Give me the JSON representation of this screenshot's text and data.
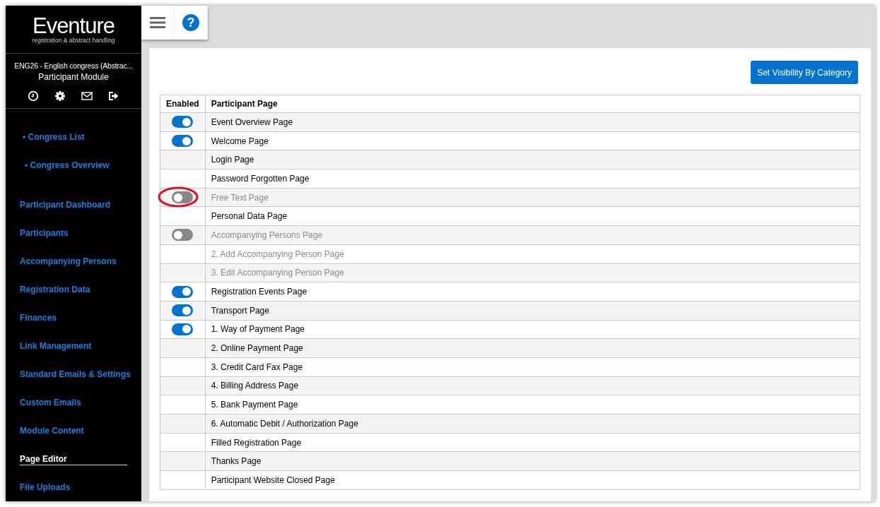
{
  "sidebar": {
    "logo": {
      "title": "Eventure",
      "tagline": "registration & abstract handling"
    },
    "congress": "ENG26 - English congress (Abstrac...",
    "module": "Participant Module",
    "items": [
      {
        "label": "• Congress List",
        "kind": "sub",
        "selected": false
      },
      {
        "label": "• Congress Overview",
        "kind": "sub",
        "selected": false
      },
      {
        "label": "Participant Dashboard",
        "kind": "main",
        "selected": false
      },
      {
        "label": "Participants",
        "kind": "main",
        "selected": false
      },
      {
        "label": "Accompanying Persons",
        "kind": "main",
        "selected": false
      },
      {
        "label": "Registration Data",
        "kind": "main",
        "selected": false
      },
      {
        "label": "Finances",
        "kind": "main",
        "selected": false
      },
      {
        "label": "Link Management",
        "kind": "main",
        "selected": false
      },
      {
        "label": "Standard Emails & Settings",
        "kind": "main",
        "selected": false
      },
      {
        "label": "Custom Emails",
        "kind": "main",
        "selected": false
      },
      {
        "label": "Module Content",
        "kind": "main",
        "selected": false
      },
      {
        "label": "Page Editor",
        "kind": "main",
        "selected": true
      },
      {
        "label": "File Uploads",
        "kind": "main",
        "selected": false
      }
    ]
  },
  "toolbar": {
    "help_glyph": "?"
  },
  "button": "Set Visibility By Category",
  "table": {
    "columns": [
      "Enabled",
      "Participant Page"
    ],
    "rows": [
      {
        "page": "Event Overview Page",
        "kind": "toggle",
        "on": true,
        "disabled": false,
        "highlighted": false
      },
      {
        "page": "Welcome Page",
        "kind": "toggle",
        "on": true,
        "disabled": false,
        "highlighted": false
      },
      {
        "page": "Login Page",
        "kind": "plain",
        "disabled": false,
        "highlighted": false
      },
      {
        "page": "Password Forgotten Page",
        "kind": "plain",
        "disabled": false,
        "highlighted": false
      },
      {
        "page": "Free Text Page",
        "kind": "toggle",
        "on": false,
        "disabled": true,
        "highlighted": true
      },
      {
        "page": "Personal Data Page",
        "kind": "plain",
        "disabled": false,
        "highlighted": false
      },
      {
        "page": "Accompanying Persons Page",
        "kind": "toggle",
        "on": false,
        "disabled": true,
        "highlighted": false
      },
      {
        "page": "2. Add Accompanying Person Page",
        "kind": "plain",
        "disabled": true,
        "highlighted": false
      },
      {
        "page": "3. Edit Accompanying Person Page",
        "kind": "plain",
        "disabled": true,
        "highlighted": false
      },
      {
        "page": "Registration Events Page",
        "kind": "toggle",
        "on": true,
        "disabled": false,
        "highlighted": false
      },
      {
        "page": "Transport Page",
        "kind": "toggle",
        "on": true,
        "disabled": false,
        "highlighted": false
      },
      {
        "page": "1. Way of Payment Page",
        "kind": "toggle",
        "on": true,
        "disabled": false,
        "highlighted": false
      },
      {
        "page": "2. Online Payment Page",
        "kind": "plain",
        "disabled": false,
        "highlighted": false
      },
      {
        "page": "3. Credit Card Fax Page",
        "kind": "plain",
        "disabled": false,
        "highlighted": false
      },
      {
        "page": "4. Billing Address Page",
        "kind": "plain",
        "disabled": false,
        "highlighted": false
      },
      {
        "page": "5. Bank Payment Page",
        "kind": "plain",
        "disabled": false,
        "highlighted": false
      },
      {
        "page": "6. Automatic Debit / Authorization Page",
        "kind": "plain",
        "disabled": false,
        "highlighted": false
      },
      {
        "page": "Filled Registration Page",
        "kind": "plain",
        "disabled": false,
        "highlighted": false
      },
      {
        "page": "Thanks Page",
        "kind": "plain",
        "disabled": false,
        "highlighted": false
      },
      {
        "page": "Participant Website Closed Page",
        "kind": "plain",
        "disabled": false,
        "highlighted": false
      }
    ]
  }
}
